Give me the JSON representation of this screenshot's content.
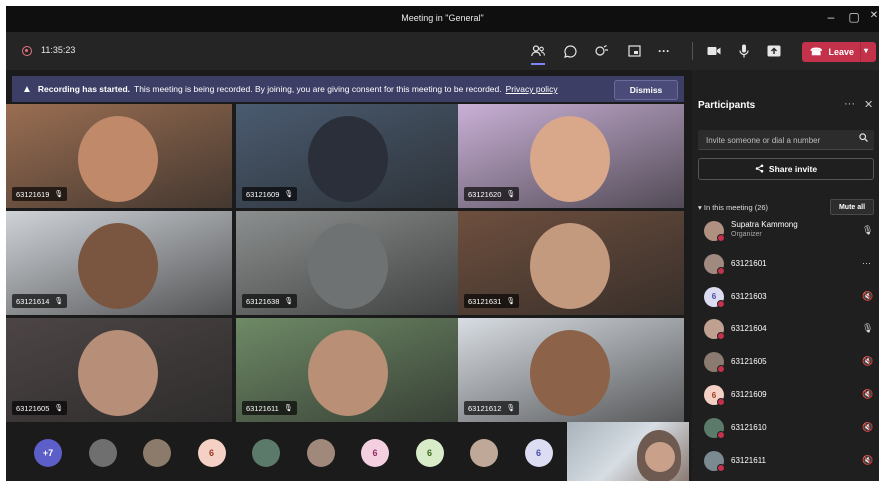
{
  "window": {
    "title": "Meeting in \"General\"",
    "minimize": "–",
    "maximize": "▢",
    "close": "✕"
  },
  "toolbar": {
    "timer": "11:35:23",
    "leave_label": "Leave",
    "icons": [
      "people-icon",
      "chat-icon",
      "reactions-icon",
      "rooms-icon",
      "more-icon",
      "camera-icon",
      "mic-icon",
      "share-icon"
    ]
  },
  "banner": {
    "bold": "Recording has started.",
    "text": "This meeting is being recorded. By joining, you are giving consent for this meeting to be recorded.",
    "link": "Privacy policy",
    "dismiss": "Dismiss"
  },
  "tiles": [
    {
      "id": "63121619",
      "bg": "#9a6e52",
      "face": "#c08a6a"
    },
    {
      "id": "63121609",
      "bg": "#4a5b70",
      "face": "#2a2f3a"
    },
    {
      "id": "63121620",
      "bg": "#c9b0d6",
      "face": "#d9a78a"
    },
    {
      "id": "63121614",
      "bg": "#cfd3d8",
      "face": "#7a5540"
    },
    {
      "id": "63121638",
      "bg": "#8c8f8f",
      "face": "#6f7272"
    },
    {
      "id": "63121631",
      "bg": "#6e4f3e",
      "face": "#c39a7e"
    },
    {
      "id": "63121605",
      "bg": "#4d4545",
      "face": "#b78e78"
    },
    {
      "id": "63121611",
      "bg": "#6e8a66",
      "face": "#b98f76"
    },
    {
      "id": "63121612",
      "bg": "#d8dde3",
      "face": "#8c6248"
    }
  ],
  "bottom_avatars": [
    {
      "text": "+7",
      "bg": "#5b5fc7",
      "fg": "#ffffff"
    },
    {
      "text": "",
      "bg": "#6f6f6f",
      "fg": "#ffffff"
    },
    {
      "text": "",
      "bg": "#8c7a6a",
      "fg": "#ffffff"
    },
    {
      "text": "6",
      "bg": "#f5d0c4",
      "fg": "#9b3b27"
    },
    {
      "text": "",
      "bg": "#5c7a6a",
      "fg": "#ffffff"
    },
    {
      "text": "",
      "bg": "#a0887a",
      "fg": "#ffffff"
    },
    {
      "text": "6",
      "bg": "#f3cfe0",
      "fg": "#9b2d63"
    },
    {
      "text": "6",
      "bg": "#d9ecc9",
      "fg": "#3b6b1f"
    },
    {
      "text": "",
      "bg": "#c0a898",
      "fg": "#ffffff"
    },
    {
      "text": "6",
      "bg": "#dcdcf2",
      "fg": "#4a4ea8"
    }
  ],
  "panel": {
    "title": "Participants",
    "more": "···",
    "close": "✕",
    "invite_placeholder": "Invite someone or dial a number",
    "share_invite": "Share invite",
    "in_meeting": "In this meeting (26)",
    "mute_all": "Mute all",
    "participants": [
      {
        "name": "Supatra Kammong",
        "role": "Organizer",
        "avatar_text": "",
        "bg": "#b09080",
        "fg": "#fff",
        "mic": "🎙"
      },
      {
        "name": "63121601",
        "role": "",
        "avatar_text": "",
        "bg": "#a08a80",
        "fg": "#fff",
        "mic": "···"
      },
      {
        "name": "63121603",
        "role": "",
        "avatar_text": "6",
        "bg": "#dcdcf2",
        "fg": "#4a4ea8",
        "mic": "🔇"
      },
      {
        "name": "63121604",
        "role": "",
        "avatar_text": "",
        "bg": "#c0a090",
        "fg": "#fff",
        "mic": "🎙"
      },
      {
        "name": "63121605",
        "role": "",
        "avatar_text": "",
        "bg": "#8a7a70",
        "fg": "#fff",
        "mic": "🔇"
      },
      {
        "name": "63121609",
        "role": "",
        "avatar_text": "6",
        "bg": "#f5d0c4",
        "fg": "#9b3b27",
        "mic": "🔇"
      },
      {
        "name": "63121610",
        "role": "",
        "avatar_text": "",
        "bg": "#5c7a6a",
        "fg": "#fff",
        "mic": "🔇"
      },
      {
        "name": "63121611",
        "role": "",
        "avatar_text": "",
        "bg": "#7a8a90",
        "fg": "#fff",
        "mic": "🔇"
      }
    ]
  }
}
